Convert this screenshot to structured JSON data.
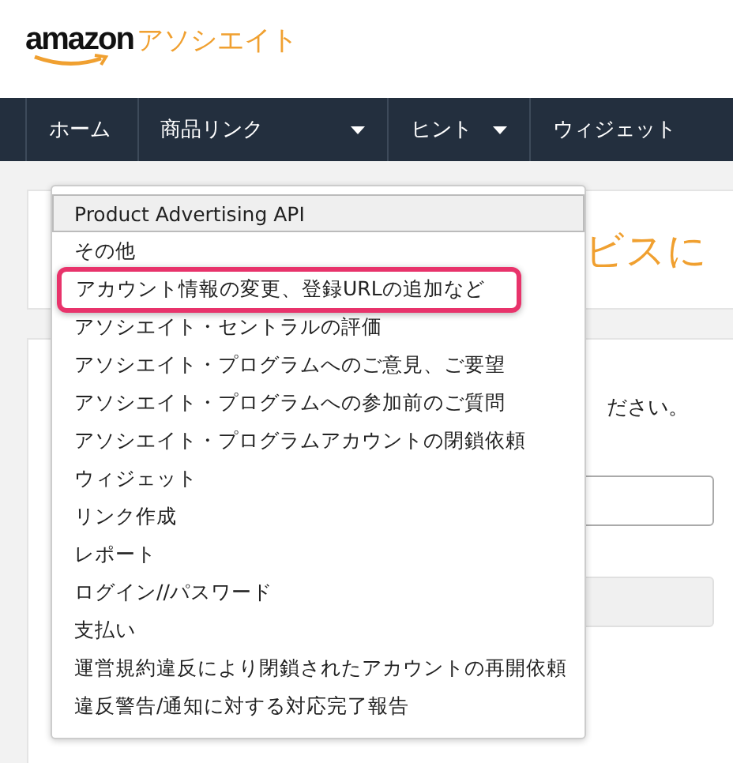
{
  "logo": {
    "brand": "amazon",
    "suffix": "アソシエイト"
  },
  "nav": [
    {
      "label": "ホーム",
      "has_caret": false
    },
    {
      "label": "商品リンク",
      "has_caret": true
    },
    {
      "label": "ヒント",
      "has_caret": true
    },
    {
      "label": "ウィジェット",
      "has_caret": false
    }
  ],
  "page": {
    "title": "ビスに",
    "instruction": "ださい。"
  },
  "dropdown": {
    "items": [
      {
        "label": "Product Advertising API",
        "selected": true,
        "highlighted": false
      },
      {
        "label": "その他",
        "selected": false,
        "highlighted": false
      },
      {
        "label": "アカウント情報の変更、登録URLの追加など",
        "selected": false,
        "highlighted": true
      },
      {
        "label": "アソシエイト・セントラルの評価",
        "selected": false,
        "highlighted": false
      },
      {
        "label": "アソシエイト・プログラムへのご意見、ご要望",
        "selected": false,
        "highlighted": false
      },
      {
        "label": "アソシエイト・プログラムへの参加前のご質問",
        "selected": false,
        "highlighted": false
      },
      {
        "label": "アソシエイト・プログラムアカウントの閉鎖依頼",
        "selected": false,
        "highlighted": false
      },
      {
        "label": "ウィジェット",
        "selected": false,
        "highlighted": false
      },
      {
        "label": "リンク作成",
        "selected": false,
        "highlighted": false
      },
      {
        "label": "レポート",
        "selected": false,
        "highlighted": false
      },
      {
        "label": "ログイン//パスワード",
        "selected": false,
        "highlighted": false
      },
      {
        "label": "支払い",
        "selected": false,
        "highlighted": false
      },
      {
        "label": "運営規約違反により閉鎖されたアカウントの再開依頼",
        "selected": false,
        "highlighted": false
      },
      {
        "label": "違反警告/通知に対する対応完了報告",
        "selected": false,
        "highlighted": false
      }
    ]
  }
}
